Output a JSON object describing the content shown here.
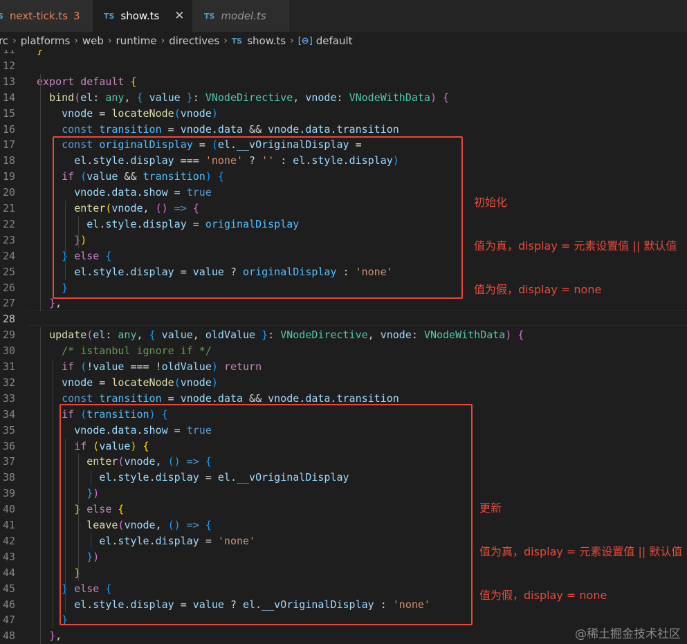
{
  "tabs": [
    {
      "name": "next-tick.ts",
      "badge": "3",
      "active": false
    },
    {
      "name": "show.ts",
      "active": true
    },
    {
      "name": "model.ts",
      "active": false
    }
  ],
  "breadcrumb": [
    "rc",
    "platforms",
    "web",
    "runtime",
    "directives",
    "show.ts",
    "default"
  ],
  "code_lines": [
    {
      "n": "11",
      "segs": [
        [
          "}",
          "b1"
        ]
      ]
    },
    {
      "n": "12",
      "segs": []
    },
    {
      "n": "13",
      "segs": [
        [
          "export",
          "kc"
        ],
        [
          " ",
          "p"
        ],
        [
          "default",
          "kc"
        ],
        [
          " ",
          "p"
        ],
        [
          "{",
          "b1"
        ]
      ]
    },
    {
      "n": "14",
      "segs": [
        [
          "  ",
          "p"
        ],
        [
          "bind",
          "fn"
        ],
        [
          "(",
          "b2"
        ],
        [
          "el",
          "v"
        ],
        [
          ": ",
          "p"
        ],
        [
          "any",
          "ty"
        ],
        [
          ", ",
          "p"
        ],
        [
          "{",
          "b3"
        ],
        [
          " ",
          "p"
        ],
        [
          "value",
          "v"
        ],
        [
          " ",
          "p"
        ],
        [
          "}",
          "b3"
        ],
        [
          ": ",
          "p"
        ],
        [
          "VNodeDirective",
          "ty"
        ],
        [
          ", ",
          "p"
        ],
        [
          "vnode",
          "v"
        ],
        [
          ": ",
          "p"
        ],
        [
          "VNodeWithData",
          "ty"
        ],
        [
          ")",
          "b2"
        ],
        [
          " ",
          "p"
        ],
        [
          "{",
          "b2"
        ]
      ]
    },
    {
      "n": "15",
      "segs": [
        [
          "    ",
          "p"
        ],
        [
          "vnode",
          "v"
        ],
        [
          " = ",
          "p"
        ],
        [
          "locateNode",
          "fn"
        ],
        [
          "(",
          "b3"
        ],
        [
          "vnode",
          "v"
        ],
        [
          ")",
          "b3"
        ]
      ]
    },
    {
      "n": "16",
      "segs": [
        [
          "    ",
          "p"
        ],
        [
          "const",
          "k"
        ],
        [
          " ",
          "p"
        ],
        [
          "transition",
          "c"
        ],
        [
          " = ",
          "p"
        ],
        [
          "vnode",
          "v"
        ],
        [
          ".",
          "p"
        ],
        [
          "data",
          "v"
        ],
        [
          " && ",
          "p"
        ],
        [
          "vnode",
          "v"
        ],
        [
          ".",
          "p"
        ],
        [
          "data",
          "v"
        ],
        [
          ".",
          "p"
        ],
        [
          "transition",
          "v"
        ]
      ]
    },
    {
      "n": "17",
      "segs": [
        [
          "    ",
          "p"
        ],
        [
          "const",
          "k"
        ],
        [
          " ",
          "p"
        ],
        [
          "originalDisplay",
          "c"
        ],
        [
          " = ",
          "p"
        ],
        [
          "(",
          "b3"
        ],
        [
          "el",
          "v"
        ],
        [
          ".",
          "p"
        ],
        [
          "__vOriginalDisplay",
          "v"
        ],
        [
          " =",
          "p"
        ]
      ]
    },
    {
      "n": "18",
      "segs": [
        [
          "      ",
          "p"
        ],
        [
          "el",
          "v"
        ],
        [
          ".",
          "p"
        ],
        [
          "style",
          "v"
        ],
        [
          ".",
          "p"
        ],
        [
          "display",
          "v"
        ],
        [
          " === ",
          "p"
        ],
        [
          "'none'",
          "s"
        ],
        [
          " ? ",
          "p"
        ],
        [
          "''",
          "s"
        ],
        [
          " : ",
          "p"
        ],
        [
          "el",
          "v"
        ],
        [
          ".",
          "p"
        ],
        [
          "style",
          "v"
        ],
        [
          ".",
          "p"
        ],
        [
          "display",
          "v"
        ],
        [
          ")",
          "b3"
        ]
      ]
    },
    {
      "n": "19",
      "segs": [
        [
          "    ",
          "p"
        ],
        [
          "if",
          "kc"
        ],
        [
          " ",
          "p"
        ],
        [
          "(",
          "b3"
        ],
        [
          "value",
          "v"
        ],
        [
          " && ",
          "p"
        ],
        [
          "transition",
          "c"
        ],
        [
          ")",
          "b3"
        ],
        [
          " ",
          "p"
        ],
        [
          "{",
          "b3"
        ]
      ]
    },
    {
      "n": "20",
      "segs": [
        [
          "      ",
          "p"
        ],
        [
          "vnode",
          "v"
        ],
        [
          ".",
          "p"
        ],
        [
          "data",
          "v"
        ],
        [
          ".",
          "p"
        ],
        [
          "show",
          "v"
        ],
        [
          " = ",
          "p"
        ],
        [
          "true",
          "k"
        ]
      ]
    },
    {
      "n": "21",
      "segs": [
        [
          "      ",
          "p"
        ],
        [
          "enter",
          "fn"
        ],
        [
          "(",
          "b1"
        ],
        [
          "vnode",
          "v"
        ],
        [
          ", ",
          "p"
        ],
        [
          "()",
          "b2"
        ],
        [
          " ",
          "p"
        ],
        [
          "=>",
          "k"
        ],
        [
          " ",
          "p"
        ],
        [
          "{",
          "b2"
        ]
      ]
    },
    {
      "n": "22",
      "segs": [
        [
          "        ",
          "p"
        ],
        [
          "el",
          "v"
        ],
        [
          ".",
          "p"
        ],
        [
          "style",
          "v"
        ],
        [
          ".",
          "p"
        ],
        [
          "display",
          "v"
        ],
        [
          " = ",
          "p"
        ],
        [
          "originalDisplay",
          "c"
        ]
      ]
    },
    {
      "n": "23",
      "segs": [
        [
          "      ",
          "p"
        ],
        [
          "}",
          "b2"
        ],
        [
          ")",
          "b1"
        ]
      ]
    },
    {
      "n": "24",
      "segs": [
        [
          "    ",
          "p"
        ],
        [
          "}",
          "b3"
        ],
        [
          " ",
          "p"
        ],
        [
          "else",
          "kc"
        ],
        [
          " ",
          "p"
        ],
        [
          "{",
          "b3"
        ]
      ]
    },
    {
      "n": "25",
      "segs": [
        [
          "      ",
          "p"
        ],
        [
          "el",
          "v"
        ],
        [
          ".",
          "p"
        ],
        [
          "style",
          "v"
        ],
        [
          ".",
          "p"
        ],
        [
          "display",
          "v"
        ],
        [
          " = ",
          "p"
        ],
        [
          "value",
          "v"
        ],
        [
          " ? ",
          "p"
        ],
        [
          "originalDisplay",
          "c"
        ],
        [
          " : ",
          "p"
        ],
        [
          "'none'",
          "s"
        ]
      ]
    },
    {
      "n": "26",
      "segs": [
        [
          "    ",
          "p"
        ],
        [
          "}",
          "b3"
        ]
      ]
    },
    {
      "n": "27",
      "segs": [
        [
          "  ",
          "p"
        ],
        [
          "}",
          "b2"
        ],
        [
          ",",
          "p"
        ]
      ]
    },
    {
      "n": "28",
      "segs": []
    },
    {
      "n": "29",
      "segs": [
        [
          "  ",
          "p"
        ],
        [
          "update",
          "fn"
        ],
        [
          "(",
          "b2"
        ],
        [
          "el",
          "v"
        ],
        [
          ": ",
          "p"
        ],
        [
          "any",
          "ty"
        ],
        [
          ", ",
          "p"
        ],
        [
          "{",
          "b3"
        ],
        [
          " ",
          "p"
        ],
        [
          "value",
          "v"
        ],
        [
          ", ",
          "p"
        ],
        [
          "oldValue",
          "v"
        ],
        [
          " ",
          "p"
        ],
        [
          "}",
          "b3"
        ],
        [
          ": ",
          "p"
        ],
        [
          "VNodeDirective",
          "ty"
        ],
        [
          ", ",
          "p"
        ],
        [
          "vnode",
          "v"
        ],
        [
          ": ",
          "p"
        ],
        [
          "VNodeWithData",
          "ty"
        ],
        [
          ")",
          "b2"
        ],
        [
          " ",
          "p"
        ],
        [
          "{",
          "b2"
        ]
      ]
    },
    {
      "n": "30",
      "segs": [
        [
          "    ",
          "p"
        ],
        [
          "/* istanbul ignore if */",
          "cm"
        ]
      ]
    },
    {
      "n": "31",
      "segs": [
        [
          "    ",
          "p"
        ],
        [
          "if",
          "kc"
        ],
        [
          " ",
          "p"
        ],
        [
          "(",
          "b3"
        ],
        [
          "!",
          "p"
        ],
        [
          "value",
          "v"
        ],
        [
          " === ",
          "p"
        ],
        [
          "!",
          "p"
        ],
        [
          "oldValue",
          "v"
        ],
        [
          ")",
          "b3"
        ],
        [
          " ",
          "p"
        ],
        [
          "return",
          "kc"
        ]
      ]
    },
    {
      "n": "32",
      "segs": [
        [
          "    ",
          "p"
        ],
        [
          "vnode",
          "v"
        ],
        [
          " = ",
          "p"
        ],
        [
          "locateNode",
          "fn"
        ],
        [
          "(",
          "b3"
        ],
        [
          "vnode",
          "v"
        ],
        [
          ")",
          "b3"
        ]
      ]
    },
    {
      "n": "33",
      "segs": [
        [
          "    ",
          "p"
        ],
        [
          "const",
          "k"
        ],
        [
          " ",
          "p"
        ],
        [
          "transition",
          "c"
        ],
        [
          " = ",
          "p"
        ],
        [
          "vnode",
          "v"
        ],
        [
          ".",
          "p"
        ],
        [
          "data",
          "v"
        ],
        [
          " && ",
          "p"
        ],
        [
          "vnode",
          "v"
        ],
        [
          ".",
          "p"
        ],
        [
          "data",
          "v"
        ],
        [
          ".",
          "p"
        ],
        [
          "transition",
          "v"
        ]
      ]
    },
    {
      "n": "34",
      "segs": [
        [
          "    ",
          "p"
        ],
        [
          "if",
          "kc"
        ],
        [
          " ",
          "p"
        ],
        [
          "(",
          "b3"
        ],
        [
          "transition",
          "c"
        ],
        [
          ")",
          "b3"
        ],
        [
          " ",
          "p"
        ],
        [
          "{",
          "b3"
        ]
      ]
    },
    {
      "n": "35",
      "segs": [
        [
          "      ",
          "p"
        ],
        [
          "vnode",
          "v"
        ],
        [
          ".",
          "p"
        ],
        [
          "data",
          "v"
        ],
        [
          ".",
          "p"
        ],
        [
          "show",
          "v"
        ],
        [
          " = ",
          "p"
        ],
        [
          "true",
          "k"
        ]
      ]
    },
    {
      "n": "36",
      "segs": [
        [
          "      ",
          "p"
        ],
        [
          "if",
          "kc"
        ],
        [
          " ",
          "p"
        ],
        [
          "(",
          "b1"
        ],
        [
          "value",
          "v"
        ],
        [
          ")",
          "b1"
        ],
        [
          " ",
          "p"
        ],
        [
          "{",
          "b1"
        ]
      ]
    },
    {
      "n": "37",
      "segs": [
        [
          "        ",
          "p"
        ],
        [
          "enter",
          "fn"
        ],
        [
          "(",
          "b2"
        ],
        [
          "vnode",
          "v"
        ],
        [
          ", ",
          "p"
        ],
        [
          "()",
          "b3"
        ],
        [
          " ",
          "p"
        ],
        [
          "=>",
          "k"
        ],
        [
          " ",
          "p"
        ],
        [
          "{",
          "b3"
        ]
      ]
    },
    {
      "n": "38",
      "segs": [
        [
          "          ",
          "p"
        ],
        [
          "el",
          "v"
        ],
        [
          ".",
          "p"
        ],
        [
          "style",
          "v"
        ],
        [
          ".",
          "p"
        ],
        [
          "display",
          "v"
        ],
        [
          " = ",
          "p"
        ],
        [
          "el",
          "v"
        ],
        [
          ".",
          "p"
        ],
        [
          "__vOriginalDisplay",
          "v"
        ]
      ]
    },
    {
      "n": "39",
      "segs": [
        [
          "        ",
          "p"
        ],
        [
          "}",
          "b3"
        ],
        [
          ")",
          "b2"
        ]
      ]
    },
    {
      "n": "40",
      "segs": [
        [
          "      ",
          "p"
        ],
        [
          "}",
          "b1"
        ],
        [
          " ",
          "p"
        ],
        [
          "else",
          "kc"
        ],
        [
          " ",
          "p"
        ],
        [
          "{",
          "b1"
        ]
      ]
    },
    {
      "n": "41",
      "segs": [
        [
          "        ",
          "p"
        ],
        [
          "leave",
          "fn"
        ],
        [
          "(",
          "b2"
        ],
        [
          "vnode",
          "v"
        ],
        [
          ", ",
          "p"
        ],
        [
          "()",
          "b3"
        ],
        [
          " ",
          "p"
        ],
        [
          "=>",
          "k"
        ],
        [
          " ",
          "p"
        ],
        [
          "{",
          "b3"
        ]
      ]
    },
    {
      "n": "42",
      "segs": [
        [
          "          ",
          "p"
        ],
        [
          "el",
          "v"
        ],
        [
          ".",
          "p"
        ],
        [
          "style",
          "v"
        ],
        [
          ".",
          "p"
        ],
        [
          "display",
          "v"
        ],
        [
          " = ",
          "p"
        ],
        [
          "'none'",
          "s"
        ]
      ]
    },
    {
      "n": "43",
      "segs": [
        [
          "        ",
          "p"
        ],
        [
          "}",
          "b3"
        ],
        [
          ")",
          "b2"
        ]
      ]
    },
    {
      "n": "44",
      "segs": [
        [
          "      ",
          "p"
        ],
        [
          "}",
          "b1"
        ]
      ]
    },
    {
      "n": "45",
      "segs": [
        [
          "    ",
          "p"
        ],
        [
          "}",
          "b3"
        ],
        [
          " ",
          "p"
        ],
        [
          "else",
          "kc"
        ],
        [
          " ",
          "p"
        ],
        [
          "{",
          "b3"
        ]
      ]
    },
    {
      "n": "46",
      "segs": [
        [
          "      ",
          "p"
        ],
        [
          "el",
          "v"
        ],
        [
          ".",
          "p"
        ],
        [
          "style",
          "v"
        ],
        [
          ".",
          "p"
        ],
        [
          "display",
          "v"
        ],
        [
          " = ",
          "p"
        ],
        [
          "value",
          "v"
        ],
        [
          " ? ",
          "p"
        ],
        [
          "el",
          "v"
        ],
        [
          ".",
          "p"
        ],
        [
          "__vOriginalDisplay",
          "v"
        ],
        [
          " : ",
          "p"
        ],
        [
          "'none'",
          "s"
        ]
      ]
    },
    {
      "n": "47",
      "segs": [
        [
          "    ",
          "p"
        ],
        [
          "}",
          "b3"
        ]
      ]
    },
    {
      "n": "48",
      "segs": [
        [
          "  ",
          "p"
        ],
        [
          "}",
          "b2"
        ],
        [
          ",",
          "p"
        ]
      ]
    }
  ],
  "annotations": [
    {
      "lines": [
        "初始化",
        "值为真，display = 元素设置值 || 默认值",
        "值为假，display = none"
      ]
    },
    {
      "lines": [
        "更新",
        "值为真，display = 元素设置值 || 默认值",
        "值为假，display = none"
      ]
    }
  ],
  "watermark": "@稀土掘金技术社区",
  "colors": {
    "box": "#e8473a",
    "annotation": "#e84a3c",
    "background": "#1e1e1e"
  }
}
